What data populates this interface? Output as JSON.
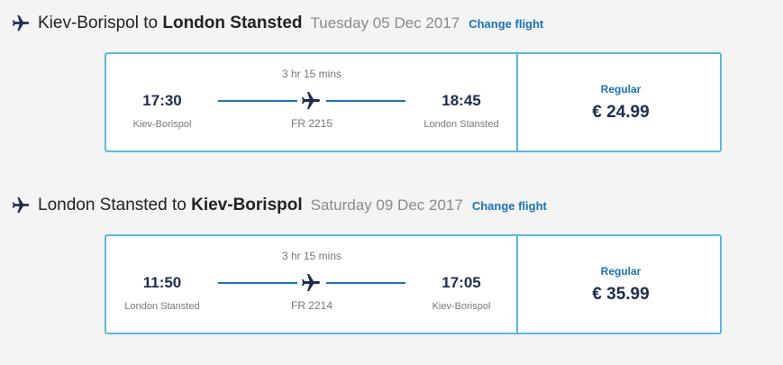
{
  "legs": [
    {
      "route_from": "Kiev-Borispol",
      "route_connector": "to",
      "route_to": "London Stansted",
      "date": "Tuesday 05 Dec 2017",
      "change_label": "Change flight",
      "depart_time": "17:30",
      "depart_city": "Kiev-Borispol",
      "duration": "3 hr 15 mins",
      "flight_number": "FR 2215",
      "arrive_time": "18:45",
      "arrive_city": "London Stansted",
      "fare_type": "Regular",
      "price": "€ 24.99"
    },
    {
      "route_from": "London Stansted",
      "route_connector": "to",
      "route_to": "Kiev-Borispol",
      "date": "Saturday 09 Dec 2017",
      "change_label": "Change flight",
      "depart_time": "11:50",
      "depart_city": "London Stansted",
      "duration": "3 hr 15 mins",
      "flight_number": "FR 2214",
      "arrive_time": "17:05",
      "arrive_city": "Kiev-Borispol",
      "fare_type": "Regular",
      "price": "€ 35.99"
    }
  ],
  "icons": {
    "header": "airplane-icon",
    "route": "airplane-icon"
  },
  "colors": {
    "accent": "#1a73b8",
    "card_border": "#5bb7d9",
    "dark_text": "#1d2d50"
  }
}
